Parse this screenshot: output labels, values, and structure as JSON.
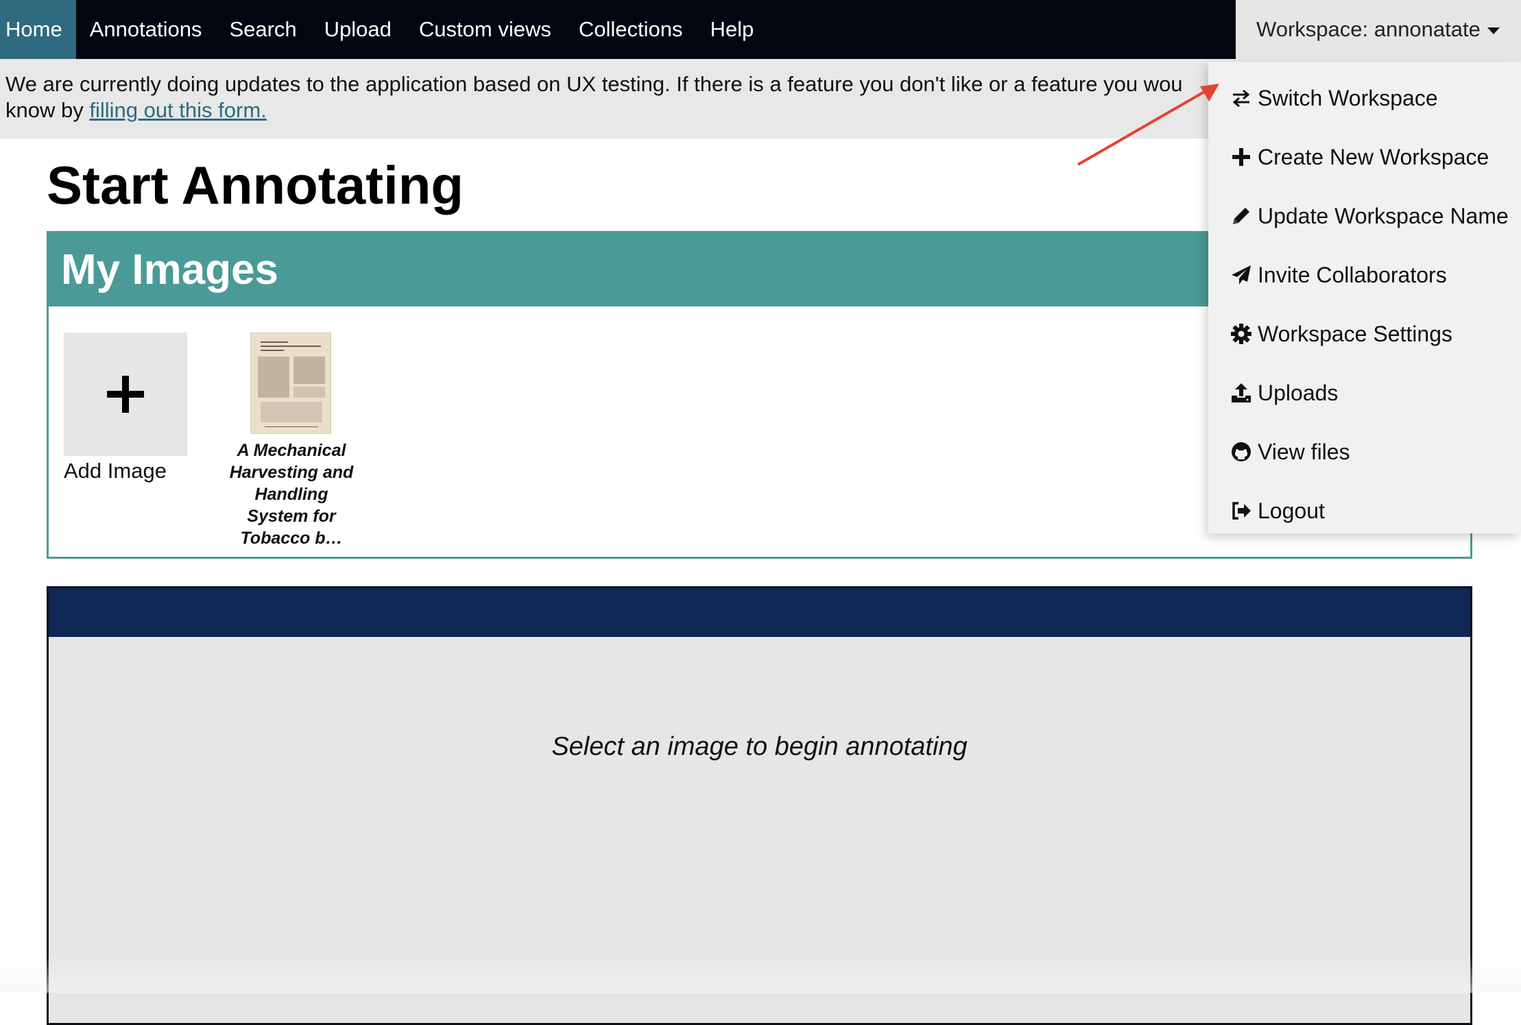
{
  "nav": {
    "items": [
      {
        "label": "Home"
      },
      {
        "label": "Annotations"
      },
      {
        "label": "Search"
      },
      {
        "label": "Upload"
      },
      {
        "label": "Custom views"
      },
      {
        "label": "Collections"
      },
      {
        "label": "Help"
      }
    ],
    "workspace_toggle": "Workspace: annonatate"
  },
  "notice": {
    "line1": "We are currently doing updates to the application based on UX testing. If there is a feature you don't like or a feature you wou",
    "line2_prefix": "know by ",
    "link_text": "filling out this form."
  },
  "page_title": "Start Annotating",
  "my_images": {
    "title": "My Images",
    "add_image_label": "Add Image",
    "images": [
      {
        "caption": "A Mechanical Harvesting and Handling System for Tobacco b…"
      }
    ]
  },
  "viewer": {
    "placeholder": "Select an image to begin annotating"
  },
  "workspace_menu": {
    "items": [
      {
        "label": "Switch Workspace",
        "icon": "exchange-icon"
      },
      {
        "label": "Create New Workspace",
        "icon": "plus-icon"
      },
      {
        "label": "Update Workspace Name",
        "icon": "pencil-icon"
      },
      {
        "label": "Invite Collaborators",
        "icon": "paper-plane-icon"
      },
      {
        "label": "Workspace Settings",
        "icon": "gear-icon"
      },
      {
        "label": "Uploads",
        "icon": "upload-icon"
      },
      {
        "label": "View files",
        "icon": "github-icon"
      },
      {
        "label": "Logout",
        "icon": "sign-out-icon"
      }
    ]
  },
  "colors": {
    "nav_bg": "#020611",
    "nav_active": "#2e6a80",
    "teal": "#4a9a97",
    "viewer_header": "#0f2755",
    "annotation_arrow": "#e2442f"
  }
}
